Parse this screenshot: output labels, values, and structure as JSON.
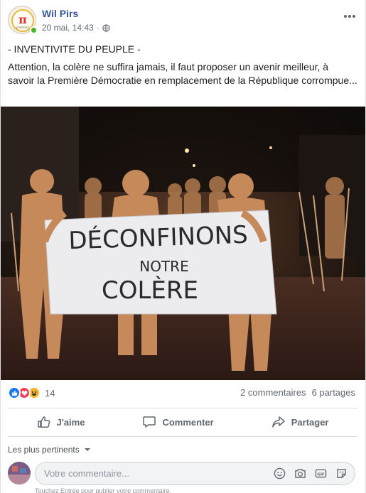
{
  "post": {
    "author": "Wil Pirs",
    "date": "20 mai, 14:43",
    "separator": "·",
    "privacy_icon": "globe-icon",
    "title_line": "- INVENTIVITE DU PEUPLE -",
    "body": "Attention, la colère ne suffira jamais, il faut proposer un avenir meilleur, à savoir la Première Démocratie en remplacement de la République corrompue..."
  },
  "avatar": {
    "logo_letters": "π",
    "logo_caption": "première"
  },
  "photo": {
    "banner_line1": "DÉCONFINONS",
    "banner_line2": "NOTRE",
    "banner_line3": "COLÈRE"
  },
  "reactions": {
    "count": "14",
    "types": [
      "like",
      "love",
      "haha"
    ],
    "comments": "2 commentaires",
    "shares": "6 partages"
  },
  "actions": {
    "like": "J'aime",
    "comment": "Commenter",
    "share": "Partager"
  },
  "comments": {
    "sort_label": "Les plus pertinents",
    "placeholder": "Votre commentaire...",
    "hint": "Touchez Entrée pour publier votre commentaire."
  },
  "colors": {
    "link_blue": "#365899",
    "like_blue": "#1877f2",
    "love_red": "#f33e58",
    "haha_yellow": "#f7b125",
    "online_green": "#42b72a"
  }
}
